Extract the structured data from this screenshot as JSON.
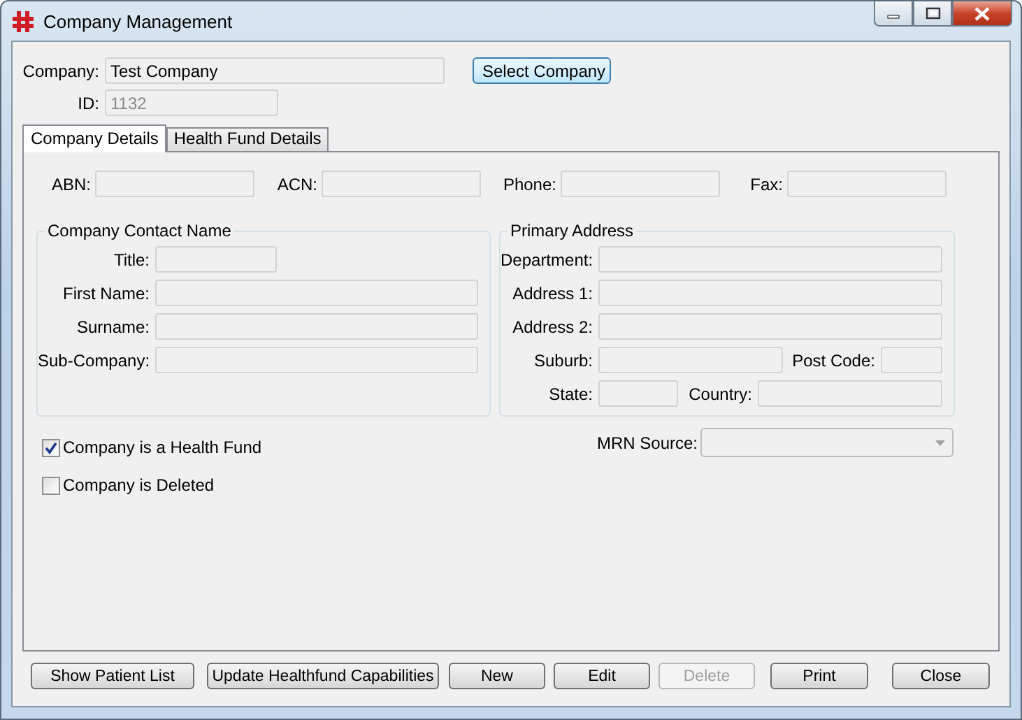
{
  "window": {
    "title": "Company Management"
  },
  "company": {
    "label": "Company:",
    "value": "Test Company",
    "disabled": false
  },
  "id": {
    "label": "ID:",
    "value": "1132",
    "disabled": true
  },
  "select_button": {
    "label": "Select Company"
  },
  "tabs": [
    {
      "label": "Company Details",
      "selected": true
    },
    {
      "label": "Health Fund Details",
      "selected": false
    }
  ],
  "identifiers": [
    {
      "label": "ABN:"
    },
    {
      "label": "ACN:"
    },
    {
      "label": "Phone:"
    },
    {
      "label": "Fax:"
    }
  ],
  "contact_group": {
    "title": "Company Contact Name",
    "fields": [
      {
        "label": "Title:"
      },
      {
        "label": "First Name:"
      },
      {
        "label": "Surname:"
      },
      {
        "label": "Sub-Company:"
      }
    ]
  },
  "address_group": {
    "title": "Primary Address",
    "rows": [
      [
        {
          "label": "Department:"
        }
      ],
      [
        {
          "label": "Address 1:"
        }
      ],
      [
        {
          "label": "Address 2:"
        }
      ],
      [
        {
          "label": "Suburb:"
        },
        {
          "label": "Post Code:"
        }
      ],
      [
        {
          "label": "State:"
        },
        {
          "label": "Country:"
        }
      ]
    ]
  },
  "checkboxes": [
    {
      "label": "Company is a Health Fund",
      "checked": true
    },
    {
      "label": "Company is Deleted",
      "checked": false
    }
  ],
  "mrn_source": {
    "label": "MRN Source:"
  },
  "buttons": [
    {
      "label": "Show Patient List",
      "disabled": false
    },
    {
      "label": "Update Healthfund Capabilities",
      "disabled": false
    },
    {
      "label": "New",
      "disabled": false
    },
    {
      "label": "Edit",
      "disabled": false
    },
    {
      "label": "Delete",
      "disabled": true
    },
    {
      "label": "Print",
      "disabled": false
    },
    {
      "label": "Close",
      "disabled": false
    }
  ]
}
